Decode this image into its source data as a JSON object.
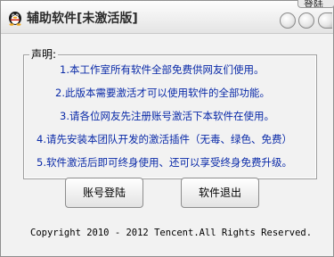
{
  "window": {
    "title": "辅助软件[未激活版]",
    "top_tab_label": "登陆"
  },
  "notice": {
    "label": "声明:",
    "items": [
      "1.本工作室所有软件全部免费供网友们使用。",
      "2.此版本需要激活才可以使用软件的全部功能。",
      "3.请各位网友先注册账号激活下本软件在使用。",
      "4.请先安装本团队开发的激活插件（无毒、绿色、免费）",
      "5.软件激活后即可终身使用、还可以享受终身免费升级。"
    ]
  },
  "buttons": {
    "login": "账号登陆",
    "exit": "软件退出"
  },
  "footer": {
    "copyright": "Copyright  2010 - 2012 Tencent.All Rights Reserved."
  },
  "colors": {
    "notice_text": "#0a2aa8",
    "window_bg": "#f2f2f2"
  }
}
